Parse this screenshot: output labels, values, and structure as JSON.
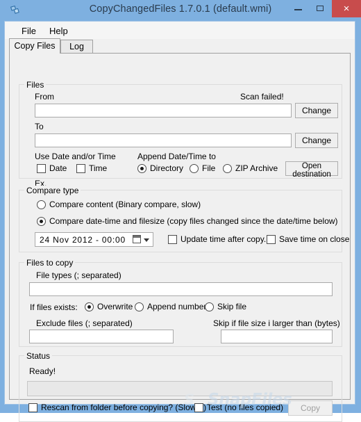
{
  "window": {
    "title": "CopyChangedFiles 1.7.0.1 (default.wmi)",
    "icon": "copy-files-icon",
    "titlebar_color": "#7eb0e0",
    "close_button_color": "#c84c4c",
    "controls": {
      "minimize": "minimize-icon",
      "maximize": "maximize-icon",
      "close": "×"
    }
  },
  "menubar": {
    "items": [
      {
        "label": "File"
      },
      {
        "label": "Help"
      }
    ]
  },
  "tabs": [
    {
      "label": "Copy Files",
      "active": true
    },
    {
      "label": "Log",
      "active": false
    }
  ],
  "files_group": {
    "legend": "Files",
    "from_label": "From",
    "from_value": "",
    "scan_status": "Scan failed!",
    "from_change_button": "Change",
    "to_label": "To",
    "to_value": "",
    "to_change_button": "Change",
    "use_date_time_label": "Use Date and/or Time",
    "date_checkbox": {
      "label": "Date",
      "checked": false
    },
    "time_checkbox": {
      "label": "Time",
      "checked": false
    },
    "append_label": "Append Date/Time to",
    "append_options": [
      {
        "label": "Directory",
        "selected": true
      },
      {
        "label": "File",
        "selected": false
      },
      {
        "label": "ZIP Archive",
        "selected": false
      }
    ],
    "open_destination_button": "Open destination",
    "example_label": "Ex.",
    "example_value": ""
  },
  "compare_group": {
    "legend": "Compare type",
    "options": [
      {
        "label": "Compare content (Binary compare, slow)",
        "selected": false
      },
      {
        "label": "Compare date-time and filesize (copy files changed since the date/time below)",
        "selected": true
      }
    ],
    "datetime_value": "24  Nov  2012  -  00:00",
    "calendar_icon": "calendar-icon",
    "dropdown_icon": "chevron-down-icon",
    "update_time_checkbox": {
      "label": "Update time after copy.",
      "checked": false
    },
    "save_time_checkbox": {
      "label": "Save time on close",
      "checked": false
    }
  },
  "files_to_copy_group": {
    "legend": "Files to copy",
    "file_types_label": "File types (; separated)",
    "file_types_value": "",
    "if_exists_label": "If files exists:",
    "if_exists_options": [
      {
        "label": "Overwrite",
        "selected": true
      },
      {
        "label": "Append number",
        "selected": false
      },
      {
        "label": "Skip file",
        "selected": false
      }
    ],
    "exclude_label": "Exclude files (; separated)",
    "exclude_value": "",
    "skip_size_label": "Skip if file size i larger than (bytes)",
    "skip_size_value": ""
  },
  "status_group": {
    "legend": "Status",
    "status_text": "Ready!",
    "progress_percent": 0,
    "rescan_checkbox": {
      "label": "Rescan from folder before copying? (Slower)",
      "checked": false
    },
    "test_checkbox": {
      "label": "Test (no files copied)",
      "checked": false
    },
    "copy_button": {
      "label": "Copy",
      "disabled": true
    }
  },
  "watermark": {
    "mark": "S",
    "text": "SnapFiles"
  }
}
